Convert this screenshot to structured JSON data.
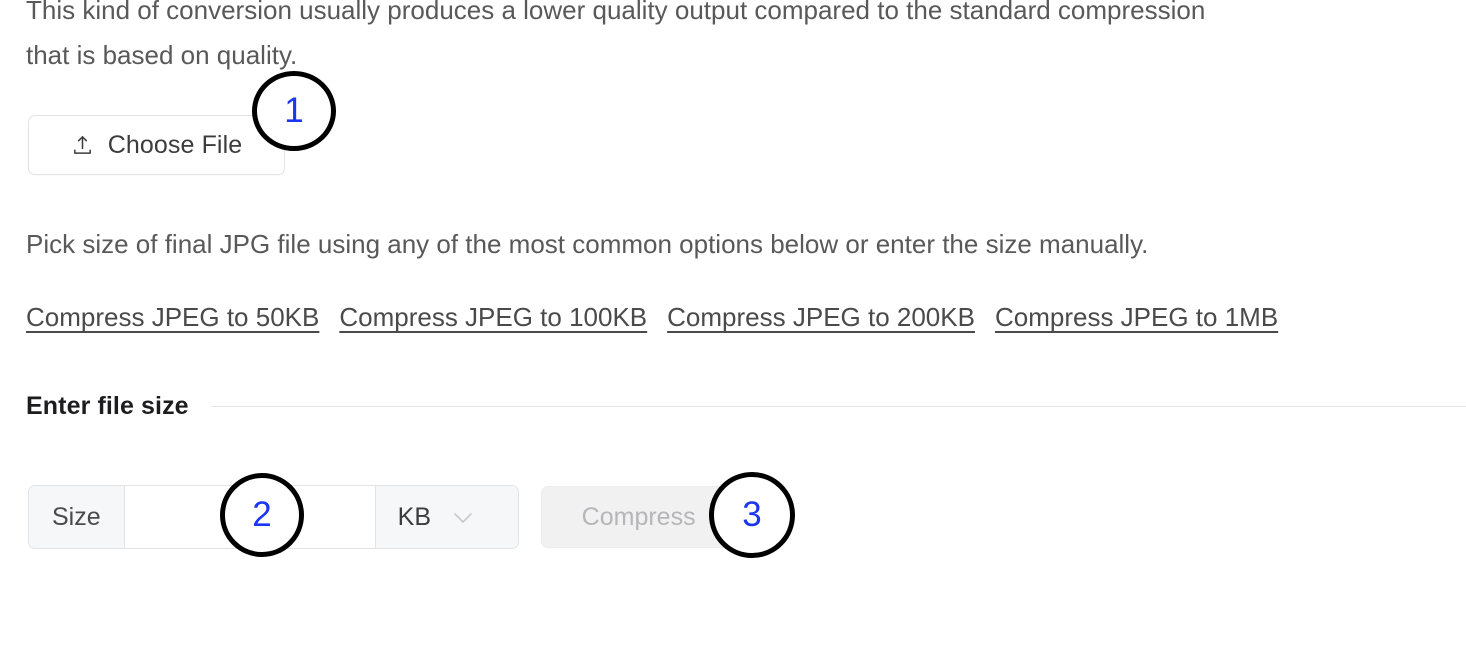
{
  "intro": {
    "line1": "This kind of conversion usually produces a lower quality output compared to the standard compression",
    "line2": "that is based on quality."
  },
  "upload": {
    "button_label": "Choose File",
    "icon": "upload-icon"
  },
  "pick_size": {
    "text": "Pick size of final JPG file using any of the most common options below or enter the size manually."
  },
  "preset_links": [
    {
      "label": "Compress JPEG to 50KB"
    },
    {
      "label": "Compress JPEG to 100KB"
    },
    {
      "label": "Compress JPEG to 200KB"
    },
    {
      "label": "Compress JPEG to 1MB"
    }
  ],
  "section": {
    "title": "Enter file size"
  },
  "size_form": {
    "addon_label": "Size",
    "input_value": "",
    "input_placeholder": "",
    "unit_selected": "KB",
    "unit_icon": "chevron-down-icon",
    "submit_label": "Compress"
  },
  "annotations": [
    {
      "number": "1"
    },
    {
      "number": "2"
    },
    {
      "number": "3"
    }
  ],
  "colors": {
    "annotation_number": "#1a37ef",
    "annotation_ring": "#000000",
    "body_text": "#595959",
    "heading_text": "#1d1d1f",
    "link_text": "#4a4a4a",
    "disabled_button_text": "#b6b6b8",
    "addon_background": "#f6f7f8",
    "border": "#e2e3e5"
  }
}
